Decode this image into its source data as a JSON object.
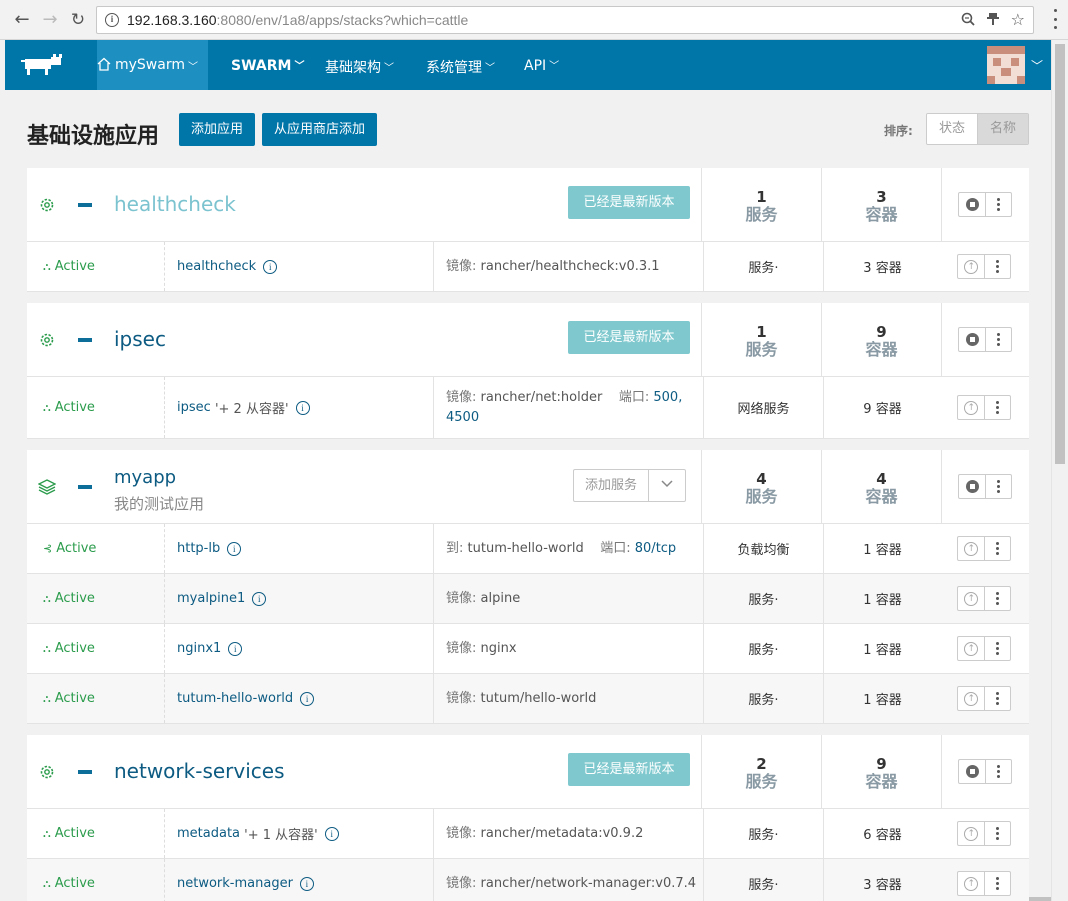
{
  "browser": {
    "url_host": "192.168.3.160",
    "url_rest": ":8080/env/1a8/apps/stacks?which=cattle"
  },
  "header": {
    "env": "mySwarm",
    "items": [
      "SWARM",
      "基础架构",
      "系统管理",
      "API"
    ]
  },
  "page": {
    "title": "基础设施应用",
    "add_stack": "添加应用",
    "add_catalog": "从应用商店添加",
    "sort_label": "排序:",
    "sort_state": "状态",
    "sort_name": "名称"
  },
  "common": {
    "upgrade_label": "已经是最新版本",
    "add_service": "添加服务",
    "services_unit": "服务",
    "containers_unit": "容器"
  },
  "stacks": [
    {
      "name": "healthcheck",
      "service_count": "1",
      "container_count": "3",
      "rows": [
        {
          "state": "Active",
          "name": "healthcheck",
          "extra": "",
          "detail_label": "镜像:",
          "detail_value": "rancher/healthcheck:v0.3.1",
          "port_label": "",
          "port_value": "",
          "type": "服务·",
          "containers": "3 容器"
        }
      ]
    },
    {
      "name": "ipsec",
      "service_count": "1",
      "container_count": "9",
      "rows": [
        {
          "state": "Active",
          "name": "ipsec",
          "extra": "'+ 2 从容器'",
          "detail_label": "镜像:",
          "detail_value": "rancher/net:holder",
          "port_label": "端口:",
          "port_value": "500, 4500",
          "type": "网络服务",
          "containers": "9 容器"
        }
      ]
    },
    {
      "name": "myapp",
      "description": "我的测试应用",
      "service_count": "4",
      "container_count": "4",
      "rows": [
        {
          "state": "Active",
          "name": "http-lb",
          "extra": "",
          "detail_label": "到:",
          "detail_value": "tutum-hello-world",
          "port_label": "端口:",
          "port_value": "80/tcp",
          "type": "负载均衡",
          "containers": "1 容器"
        },
        {
          "state": "Active",
          "name": "myalpine1",
          "extra": "",
          "detail_label": "镜像:",
          "detail_value": "alpine",
          "port_label": "",
          "port_value": "",
          "type": "服务·",
          "containers": "1 容器"
        },
        {
          "state": "Active",
          "name": "nginx1",
          "extra": "",
          "detail_label": "镜像:",
          "detail_value": "nginx",
          "port_label": "",
          "port_value": "",
          "type": "服务·",
          "containers": "1 容器"
        },
        {
          "state": "Active",
          "name": "tutum-hello-world",
          "extra": "",
          "detail_label": "镜像:",
          "detail_value": "tutum/hello-world",
          "port_label": "",
          "port_value": "",
          "type": "服务·",
          "containers": "1 容器"
        }
      ]
    },
    {
      "name": "network-services",
      "service_count": "2",
      "container_count": "9",
      "rows": [
        {
          "state": "Active",
          "name": "metadata",
          "extra": "'+ 1 从容器'",
          "detail_label": "镜像:",
          "detail_value": "rancher/metadata:v0.9.2",
          "port_label": "",
          "port_value": "",
          "type": "服务·",
          "containers": "6 容器"
        },
        {
          "state": "Active",
          "name": "network-manager",
          "extra": "",
          "detail_label": "镜像:",
          "detail_value": "rancher/network-manager:v0.7.4",
          "port_label": "",
          "port_value": "",
          "type": "服务·",
          "containers": "3 容器"
        }
      ]
    }
  ]
}
